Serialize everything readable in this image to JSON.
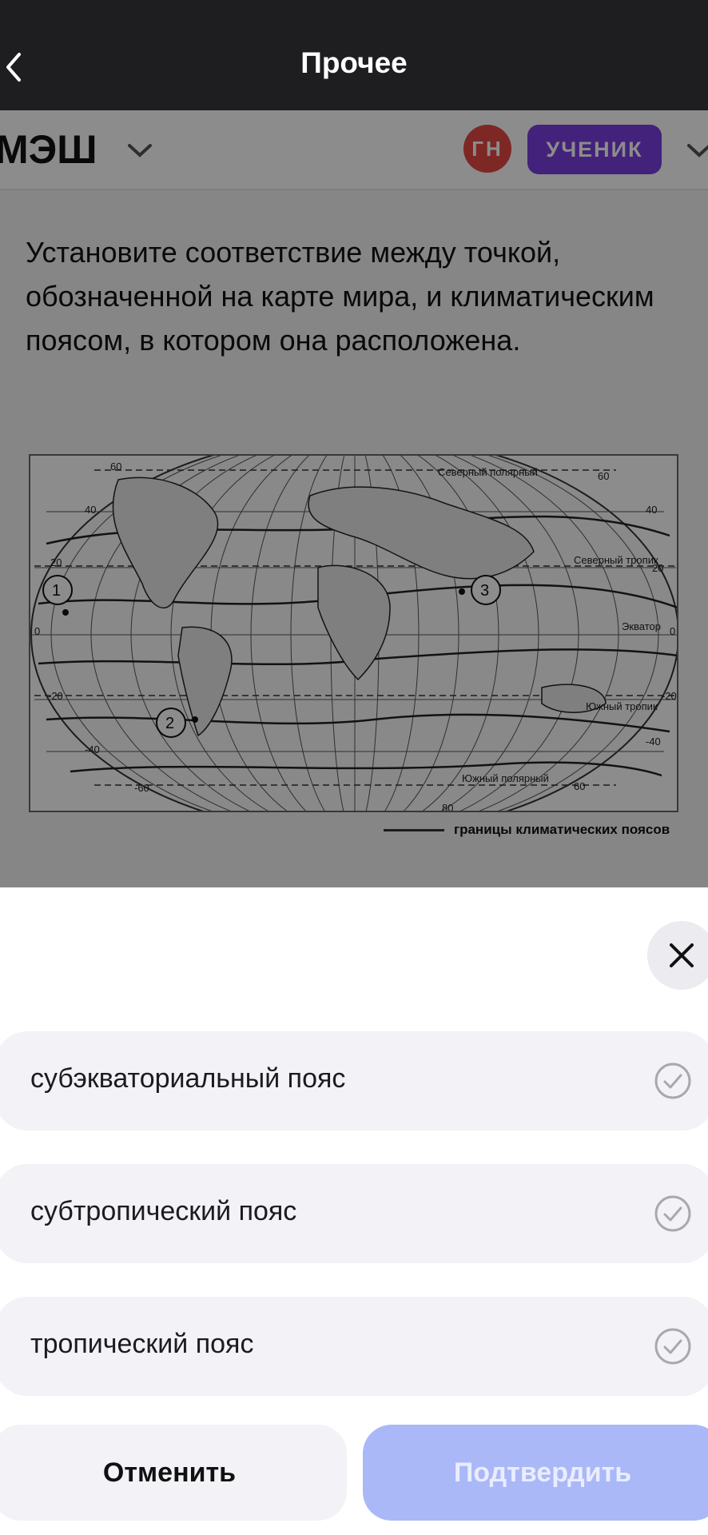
{
  "topbar": {
    "title": "Прочее",
    "back_icon": "chevron-left-icon"
  },
  "app_header": {
    "logo": "МЭШ",
    "avatar_initials": "ГН",
    "role_badge": "УЧЕНИК",
    "colors": {
      "avatar": "#e44a44",
      "role_badge": "#7b3fe0"
    }
  },
  "question": {
    "text": "Установите соответствие между точкой, обозначенной на карте мира, и климатическим поясом, в котором она расположена."
  },
  "map": {
    "labels": {
      "north_polar": "Северный полярный",
      "north_tropic": "Северный тропик",
      "equator": "Экватор",
      "south_tropic": "Южный тропик",
      "south_polar": "Южный полярный"
    },
    "latitude_ticks": [
      "60",
      "40",
      "20",
      "0",
      "-20",
      "-40",
      "-60",
      "80"
    ],
    "points": [
      "1",
      "2",
      "3"
    ],
    "legend": "границы климатических поясов"
  },
  "sheet": {
    "close_icon": "close-icon",
    "options": [
      {
        "label": "субэкваториальный пояс"
      },
      {
        "label": "субтропический пояс"
      },
      {
        "label": "тропический пояс"
      }
    ],
    "cancel_label": "Отменить",
    "confirm_label": "Подтвердить",
    "colors": {
      "confirm_bg": "#aab8f7",
      "option_bg": "#f2f2f7"
    }
  }
}
